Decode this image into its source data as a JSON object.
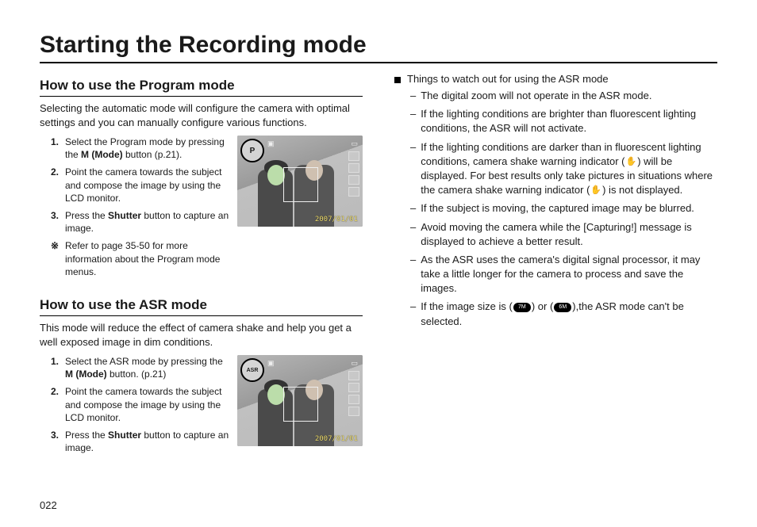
{
  "page_title": "Starting the Recording mode",
  "page_number": "022",
  "left": {
    "program": {
      "title": "How to use the Program mode",
      "intro": "Selecting the automatic mode will configure the camera with optimal settings and you can manually configure various functions.",
      "steps": [
        {
          "num": "1.",
          "txt_a": "Select the Program mode by pressing the ",
          "bold": "M (Mode)",
          "txt_b": " button (p.21)."
        },
        {
          "num": "2.",
          "txt_a": "Point the camera towards the subject and compose the image by using the LCD monitor.",
          "bold": "",
          "txt_b": ""
        },
        {
          "num": "3.",
          "txt_a": "Press the ",
          "bold": "Shutter",
          "txt_b": " button to capture an image."
        }
      ],
      "note": {
        "sym": "※",
        "txt": "Refer to page 35-50 for more information about the Program mode menus."
      },
      "lcd_badge": "P",
      "lcd_date": "2007/01/01"
    },
    "asr": {
      "title": "How to use the ASR mode",
      "intro": "This mode will reduce the effect of camera shake and help you get a well exposed image in dim conditions.",
      "steps": [
        {
          "num": "1.",
          "txt_a": "Select the ASR mode by pressing the ",
          "bold": "M (Mode)",
          "txt_b": " button. (p.21)"
        },
        {
          "num": "2.",
          "txt_a": "Point the camera towards the subject and compose the image by using the LCD monitor.",
          "bold": "",
          "txt_b": ""
        },
        {
          "num": "3.",
          "txt_a": "Press the ",
          "bold": "Shutter",
          "txt_b": " button to capture an image."
        }
      ],
      "lcd_badge": "ASR",
      "lcd_date": "2007/01/01"
    }
  },
  "right": {
    "heading": "Things to watch out for using the ASR mode",
    "items": [
      {
        "t": "The digital zoom will not operate in the ASR mode."
      },
      {
        "t": "If the lighting conditions are brighter than fluorescent lighting conditions, the ASR will not activate."
      },
      {
        "t_a": "If the lighting conditions are darker than in fluorescent lighting conditions, camera shake warning indicator (",
        "icon": "hand",
        "t_b": ") will be displayed. For best results only take pictures in situations where the camera shake warning indicator (",
        "icon2": "hand",
        "t_c": ") is not displayed."
      },
      {
        "t": "If the subject is moving, the captured image may be blurred."
      },
      {
        "t": "Avoid moving the camera while the [Capturing!] message is displayed to achieve a better result."
      },
      {
        "t": "As the ASR uses the camera's digital signal processor, it may take a little longer for the camera to process and save the images."
      },
      {
        "t_a": "If the image size is (",
        "pill1": "7M",
        "t_b": ") or (",
        "pill2": "6M",
        "t_c": "),the ASR mode can't be selected."
      }
    ]
  }
}
